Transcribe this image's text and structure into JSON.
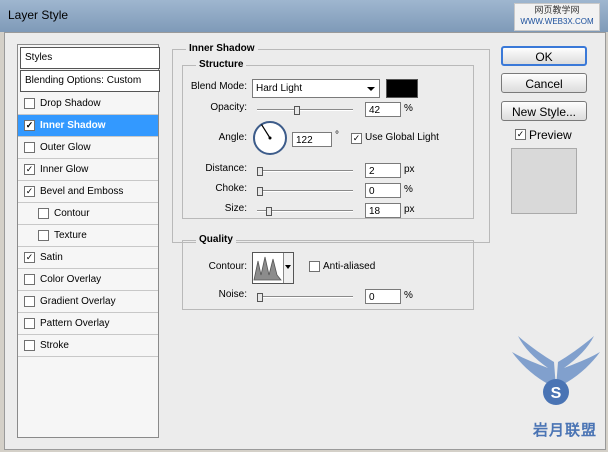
{
  "window": {
    "title": "Layer Style",
    "watermark_top": "网页教学网",
    "watermark_sub": "WWW.WEB3X.COM"
  },
  "sidebar": {
    "items": [
      {
        "label": "Styles",
        "type": "header"
      },
      {
        "label": "Blending Options: Custom",
        "type": "header"
      },
      {
        "label": "Drop Shadow",
        "checked": false
      },
      {
        "label": "Inner Shadow",
        "checked": true,
        "selected": true
      },
      {
        "label": "Outer Glow",
        "checked": false
      },
      {
        "label": "Inner Glow",
        "checked": true
      },
      {
        "label": "Bevel and Emboss",
        "checked": true
      },
      {
        "label": "Contour",
        "checked": false,
        "sub": true
      },
      {
        "label": "Texture",
        "checked": false,
        "sub": true
      },
      {
        "label": "Satin",
        "checked": true
      },
      {
        "label": "Color Overlay",
        "checked": false
      },
      {
        "label": "Gradient Overlay",
        "checked": false
      },
      {
        "label": "Pattern Overlay",
        "checked": false
      },
      {
        "label": "Stroke",
        "checked": false
      }
    ]
  },
  "inner_shadow": {
    "title": "Inner Shadow",
    "structure_title": "Structure",
    "blend_mode_label": "Blend Mode:",
    "blend_mode_value": "Hard Light",
    "shadow_color": "#000000",
    "opacity_label": "Opacity:",
    "opacity_value": "42",
    "opacity_unit": "%",
    "opacity_fraction": 0.42,
    "angle_label": "Angle:",
    "angle_value": "122",
    "angle_unit": "°",
    "use_global_light_label": "Use Global Light",
    "use_global_light_checked": true,
    "distance_label": "Distance:",
    "distance_value": "2",
    "distance_unit": "px",
    "distance_fraction": 0.02,
    "choke_label": "Choke:",
    "choke_value": "0",
    "choke_unit": "%",
    "choke_fraction": 0.0,
    "size_label": "Size:",
    "size_value": "18",
    "size_unit": "px",
    "size_fraction": 0.072
  },
  "quality": {
    "title": "Quality",
    "contour_label": "Contour:",
    "anti_aliased_label": "Anti-aliased",
    "anti_aliased_checked": false,
    "noise_label": "Noise:",
    "noise_value": "0",
    "noise_unit": "%",
    "noise_fraction": 0.0
  },
  "buttons": {
    "ok": "OK",
    "cancel": "Cancel",
    "new_style": "New Style...",
    "preview_label": "Preview",
    "preview_checked": true
  },
  "brand": {
    "text": "岩月联盟",
    "badge_letter": "S",
    "color": "#4a74b4"
  }
}
